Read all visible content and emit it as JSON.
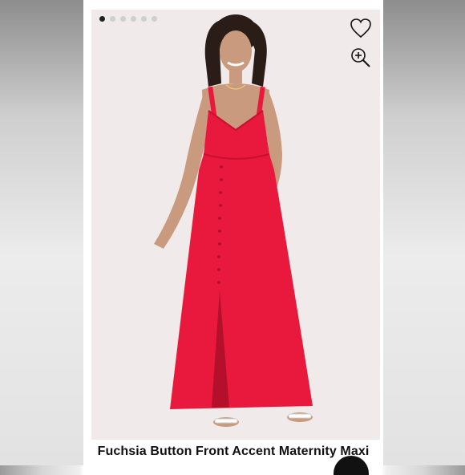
{
  "product": {
    "title": "Fuchsia Button Front Accent Maternity Maxi",
    "dress_color": "#e8193c",
    "background_color": "#f1eaea"
  },
  "gallery": {
    "image_count": 6,
    "active_index": 0
  },
  "icons": {
    "favorite": "heart-icon",
    "zoom": "zoom-in-icon"
  }
}
